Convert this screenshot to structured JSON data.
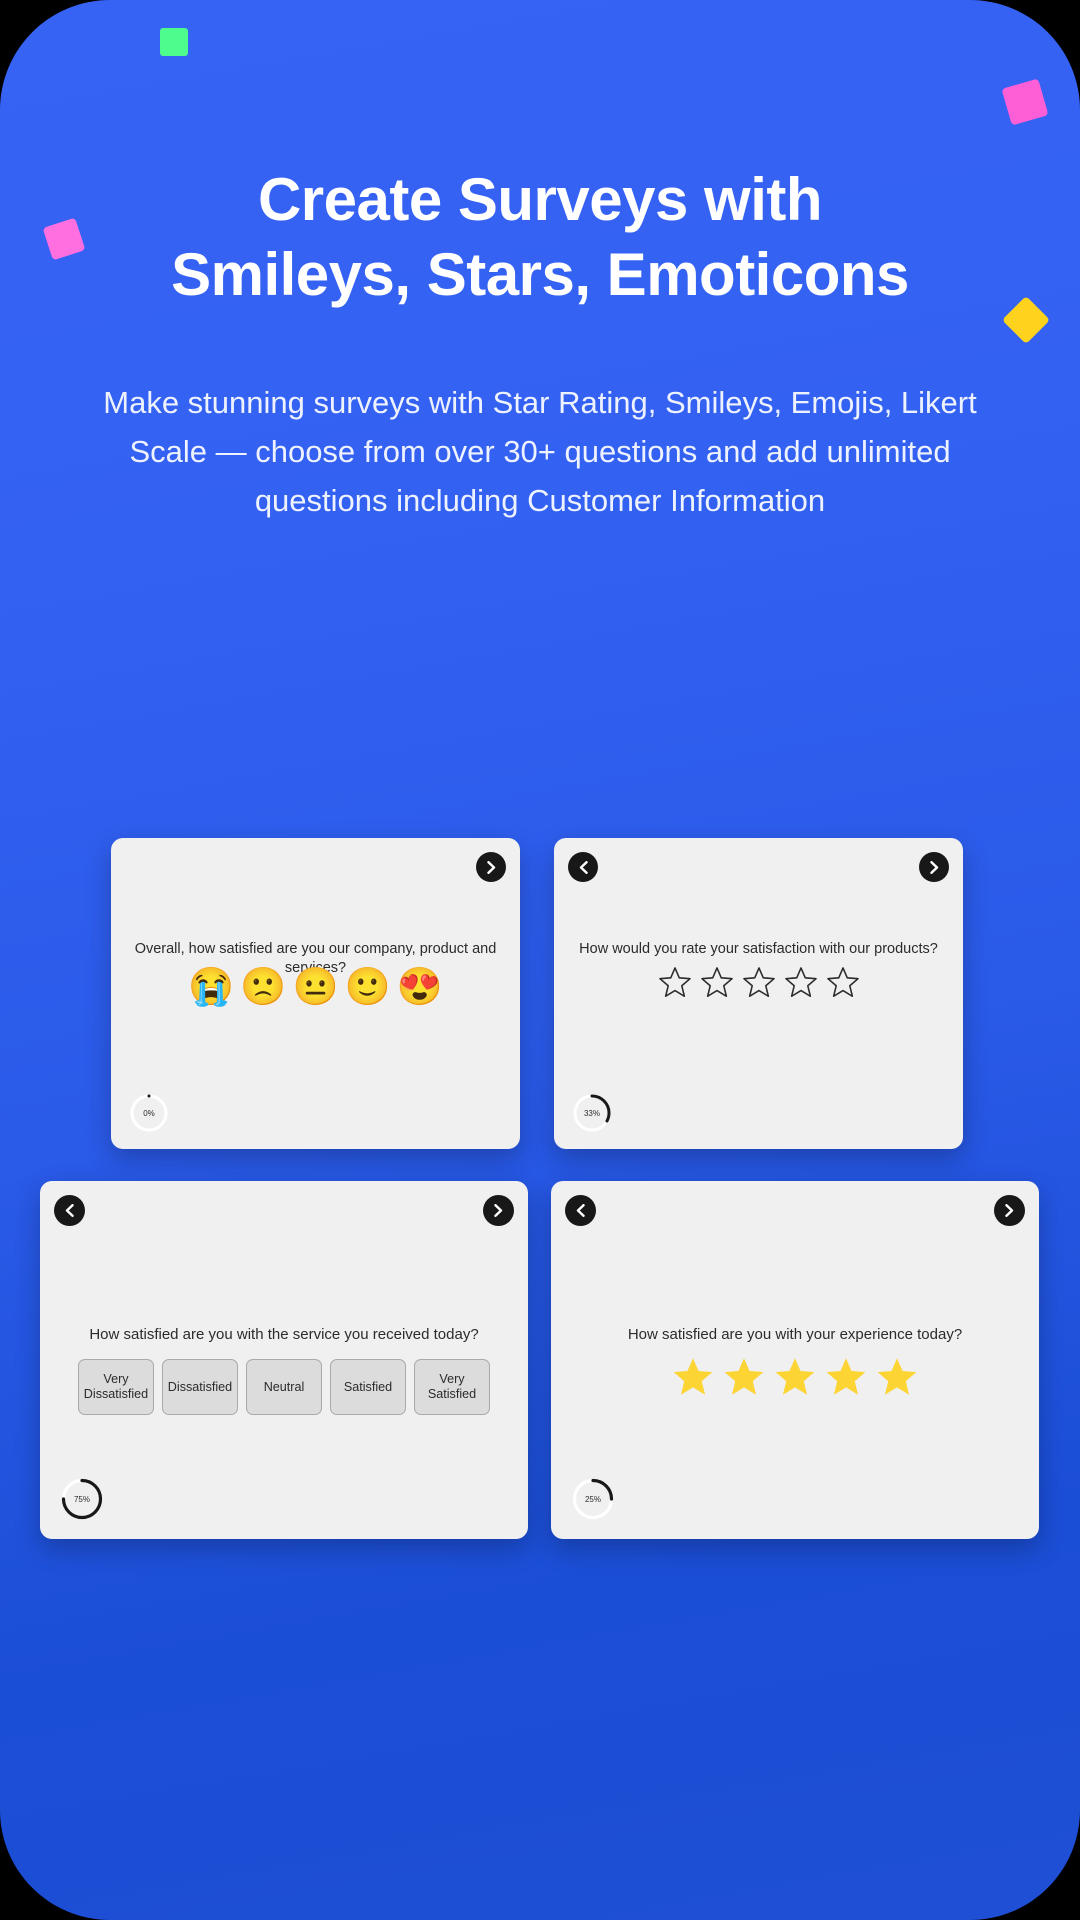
{
  "hero": {
    "headline_line1": "Create Surveys with",
    "headline_line2": "Smileys, Stars, Emoticons",
    "subheadline": "Make stunning surveys with Star Rating, Smileys, Emojis, Likert Scale — choose from over 30+ questions and add unlimited questions including Customer Information"
  },
  "theme": {
    "background": "#000000",
    "panel_gradient_from": "#3763f4",
    "panel_gradient_to": "#1e4fd4",
    "card_background": "#f0f0f0",
    "nav_button_color": "#181818",
    "star_filled_color": "#ffd21e",
    "accent_green": "#4dfc8d",
    "accent_pink": "#ff5fd6",
    "accent_yellow": "#ffd21e"
  },
  "decorations": [
    {
      "name": "green-diamond",
      "color": "#4dfc8d"
    },
    {
      "name": "pink-square-left",
      "color": "#ff6fe0"
    },
    {
      "name": "pink-square-right",
      "color": "#ff5fd6"
    },
    {
      "name": "yellow-diamond",
      "color": "#ffd21e"
    }
  ],
  "cards": [
    {
      "id": "card-smiley",
      "question": "Overall, how satisfied are you our company, product and services?",
      "type": "smiley",
      "options": [
        "😭",
        "🙁",
        "😐",
        "🙂",
        "😍"
      ],
      "option_names": [
        "crying-face",
        "frowning-face",
        "neutral-face",
        "slightly-smiling-face",
        "smiling-face-with-hearts"
      ],
      "progress_label": "0%",
      "progress_value": 0,
      "has_prev": false,
      "has_next": true
    },
    {
      "id": "card-star-empty",
      "question": "How would you rate your satisfaction with our products?",
      "type": "star-outline",
      "star_count": 5,
      "stars_filled": 0,
      "progress_label": "33%",
      "progress_value": 33,
      "has_prev": true,
      "has_next": true
    },
    {
      "id": "card-likert",
      "question": "How satisfied are you with the service you received today?",
      "type": "likert",
      "options": [
        "Very Dissatisfied",
        "Dissatisfied",
        "Neutral",
        "Satisfied",
        "Very Satisfied"
      ],
      "progress_label": "75%",
      "progress_value": 75,
      "has_prev": true,
      "has_next": true
    },
    {
      "id": "card-star-filled",
      "question": "How satisfied are you with your experience today?",
      "type": "star-filled",
      "star_count": 5,
      "stars_filled": 5,
      "progress_label": "25%",
      "progress_value": 25,
      "has_prev": true,
      "has_next": true
    }
  ],
  "icons": {
    "chevron_left": "‹",
    "chevron_right": "›"
  }
}
